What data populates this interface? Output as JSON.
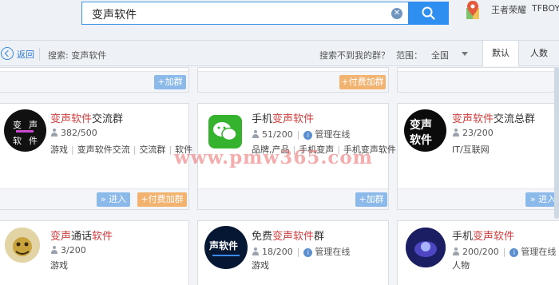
{
  "search": {
    "query": "变声软件"
  },
  "header": {
    "game_name": "王者荣耀",
    "user": "TFBOY"
  },
  "filter": {
    "back_label": "返回",
    "search_label": "搜索: 变声软件",
    "not_found": "搜索不到我的群？",
    "range_label": "范围：",
    "range_value": "全国",
    "tab_default": "默认",
    "tab_count": "人数"
  },
  "buttons": {
    "join": "+加群",
    "paid_join": "+付费加群",
    "enter": "» 进入"
  },
  "groups": [
    {
      "name_hl": "变声软件",
      "name_rest": "交流群",
      "members": "382/500",
      "tags": [
        "游戏",
        "变声软件交流",
        "交流群",
        "软件"
      ],
      "avatar_text": [
        "变",
        "声",
        "软",
        "件"
      ]
    },
    {
      "name_pre": "手机",
      "name_hl": "变声软件",
      "members": "51/200",
      "status": "管理在线",
      "tags": [
        "品牌,产品",
        "手机变声",
        "手机变声软件"
      ]
    },
    {
      "name_hl": "变声软件",
      "name_rest": "交流总群",
      "members": "23/200",
      "tags": [
        "IT/互联网"
      ],
      "avatar_text": [
        "变声",
        "软件"
      ]
    },
    {
      "name_hl": "变声",
      "name_mid": "通话",
      "name_hl2": "软件",
      "members": "3/200",
      "tags": [
        "游戏"
      ]
    },
    {
      "name_pre": "免费",
      "name_hl": "变声软件",
      "name_rest": "群",
      "members": "18/200",
      "status": "管理在线",
      "tags": [
        "游戏"
      ],
      "avatar_text": [
        "声软件"
      ]
    },
    {
      "name_pre": "手机",
      "name_hl": "变声软件",
      "members": "200/200",
      "status": "管理在线",
      "tags": [
        "人物"
      ]
    }
  ],
  "watermark": "www.pmw365.com",
  "colors": {
    "accent": "#2f8ff0",
    "highlight": "#d23c3c",
    "join_button": "#8ab9ea",
    "paid_button": "#f2b270"
  }
}
